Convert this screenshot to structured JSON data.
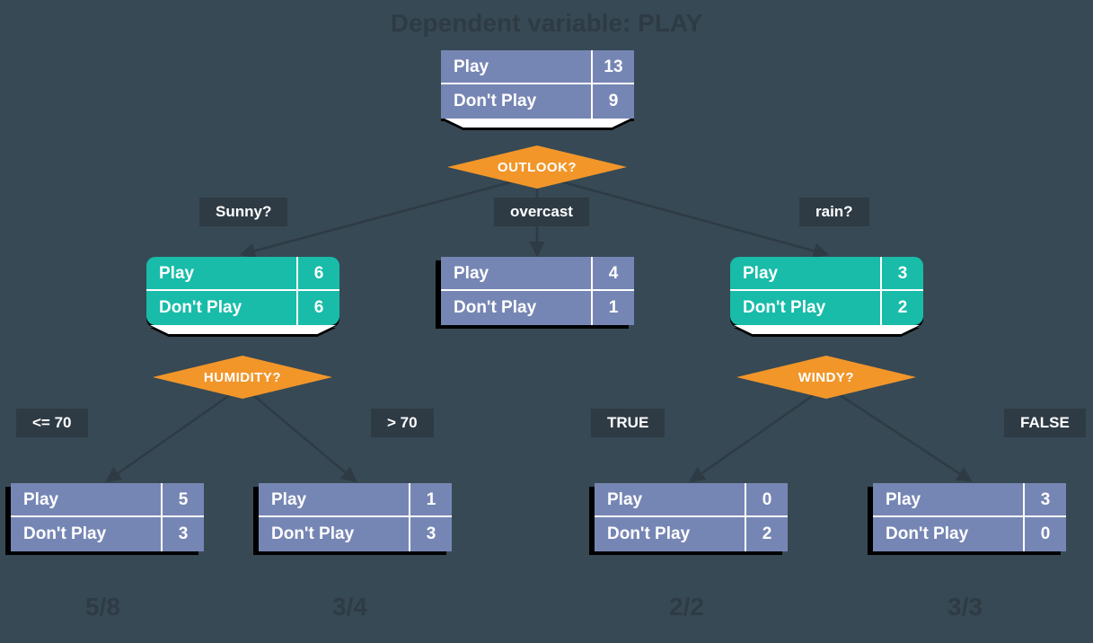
{
  "title": "Dependent variable: PLAY",
  "labels": {
    "play": "Play",
    "dont": "Don't Play"
  },
  "root": {
    "play": "13",
    "dont": "9"
  },
  "decision_outlook": "OUTLOOK?",
  "branch": {
    "sunny": "Sunny?",
    "overcast": "overcast",
    "rain": "rain?"
  },
  "sunny": {
    "play": "6",
    "dont": "6"
  },
  "overcast": {
    "play": "4",
    "dont": "1"
  },
  "rain": {
    "play": "3",
    "dont": "2"
  },
  "decision_humidity": "HUMIDITY?",
  "decision_windy": "WINDY?",
  "cond": {
    "le70": "<= 70",
    "gt70": "> 70",
    "true": "TRUE",
    "false": "FALSE"
  },
  "leaf": {
    "h_le70": {
      "play": "5",
      "dont": "3"
    },
    "h_gt70": {
      "play": "1",
      "dont": "3"
    },
    "w_true": {
      "play": "0",
      "dont": "2"
    },
    "w_false": {
      "play": "3",
      "dont": "0"
    }
  },
  "ratios": {
    "a": "5/8",
    "b": "3/4",
    "c": "2/2",
    "d": "3/3"
  },
  "chart_data": {
    "type": "table",
    "title": "Decision tree for dependent variable PLAY",
    "root": {
      "Play": 13,
      "DontPlay": 9,
      "split_on": "OUTLOOK"
    },
    "children": [
      {
        "branch": "Sunny",
        "Play": 6,
        "DontPlay": 6,
        "split_on": "HUMIDITY",
        "children": [
          {
            "branch": "<= 70",
            "Play": 5,
            "DontPlay": 3,
            "ratio": "5/8"
          },
          {
            "branch": "> 70",
            "Play": 1,
            "DontPlay": 3,
            "ratio": "3/4"
          }
        ]
      },
      {
        "branch": "overcast",
        "Play": 4,
        "DontPlay": 1
      },
      {
        "branch": "rain",
        "Play": 3,
        "DontPlay": 2,
        "split_on": "WINDY",
        "children": [
          {
            "branch": "TRUE",
            "Play": 0,
            "DontPlay": 2,
            "ratio": "2/2"
          },
          {
            "branch": "FALSE",
            "Play": 3,
            "DontPlay": 0,
            "ratio": "3/3"
          }
        ]
      }
    ]
  }
}
